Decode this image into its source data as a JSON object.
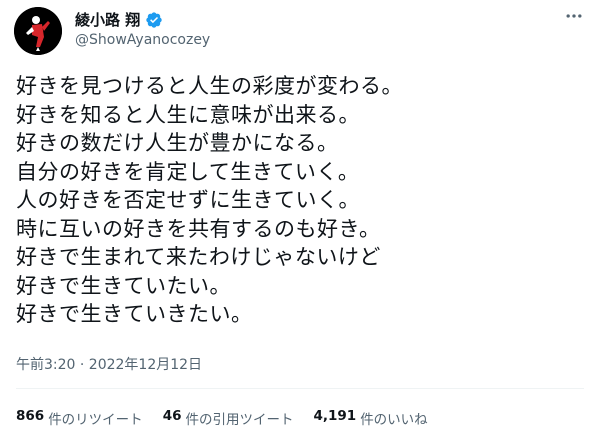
{
  "user": {
    "display_name": "綾小路 翔",
    "handle": "@ShowAyanocozey"
  },
  "tweet": {
    "lines": [
      "好きを見つけると人生の彩度が変わる。",
      "好きを知ると人生に意味が出来る。",
      "好きの数だけ人生が豊かになる。",
      "自分の好きを肯定して生きていく。",
      "人の好きを否定せずに生きていく。",
      "時に互いの好きを共有するのも好き。",
      "好きで生まれて来たわけじゃないけど",
      "好きで生きていたい。",
      "好きで生きていきたい。"
    ],
    "timestamp": "午前3:20 · 2022年12月12日"
  },
  "stats": {
    "retweets": {
      "count": "866",
      "label": "件のリツイート"
    },
    "quotes": {
      "count": "46",
      "label": "件の引用ツイート"
    },
    "likes": {
      "count": "4,191",
      "label": "件のいいね"
    }
  },
  "colors": {
    "verified": "#1d9bf0",
    "secondary_text": "#536471",
    "primary_text": "#0f1419"
  },
  "icons": {
    "verified": "verified-badge-icon",
    "more": "more-options-icon"
  }
}
